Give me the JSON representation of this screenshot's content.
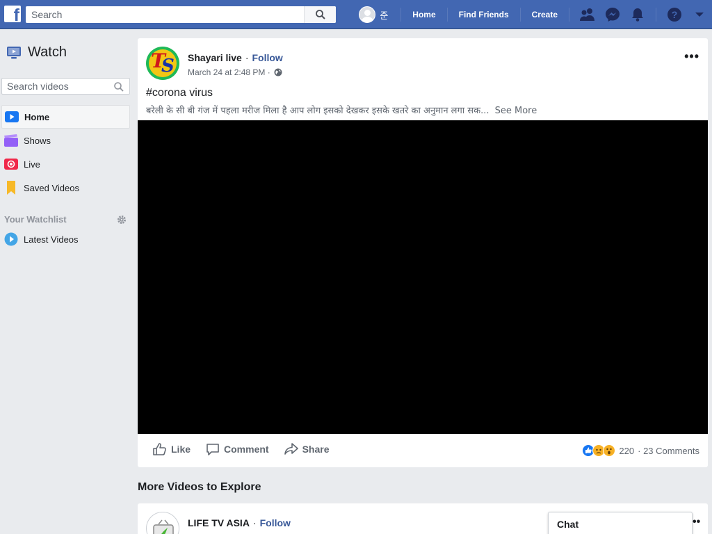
{
  "topbar": {
    "search_placeholder": "Search",
    "profile_name": "준",
    "links": [
      "Home",
      "Find Friends",
      "Create"
    ],
    "brand_color": "#4267b2"
  },
  "sidebar": {
    "title": "Watch",
    "search_placeholder": "Search videos",
    "items": [
      {
        "label": "Home",
        "icon": "play-icon",
        "active": true
      },
      {
        "label": "Shows",
        "icon": "clapper-icon"
      },
      {
        "label": "Live",
        "icon": "live-icon"
      },
      {
        "label": "Saved Videos",
        "icon": "bookmark-icon"
      }
    ],
    "watchlist_title": "Your Watchlist",
    "watchlist_items": [
      {
        "label": "Latest Videos",
        "icon": "play-circle-icon"
      }
    ]
  },
  "post": {
    "page_name": "Shayari live",
    "separator": "·",
    "follow": "Follow",
    "date": "March 24 at 2:48 PM ·",
    "title": "#corona virus",
    "text": "बरेली के सी बी गंज में पहला मरीज मिला है आप लोग इसको देखकर इसके खतरे का अनुमान लगा सक...",
    "see_more": "See More",
    "actions": [
      "Like",
      "Comment",
      "Share"
    ],
    "reaction_count": "220",
    "comments": "· 23 Comments"
  },
  "more_videos": {
    "heading": "More Videos to Explore",
    "page_name": "LIFE TV ASIA",
    "follow": "Follow"
  },
  "chat": {
    "label": "Chat"
  }
}
